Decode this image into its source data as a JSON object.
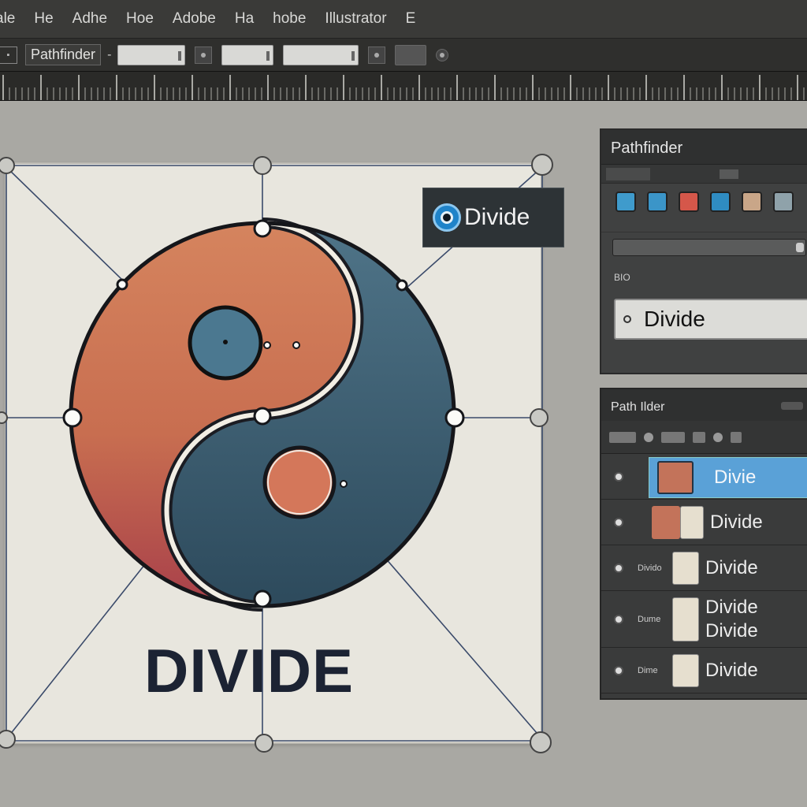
{
  "app": {
    "menu": [
      "ale",
      "He",
      "Adhe",
      "Hoe",
      "Adobe",
      "Ha",
      "hobe",
      "Illustrator",
      "E"
    ]
  },
  "control_bar": {
    "panel_label": "Pathfinder",
    "separator": "-"
  },
  "tooltip": {
    "label": "Divide"
  },
  "canvas": {
    "heading": "DIVIDE"
  },
  "pathfinder_panel": {
    "title": "Pathfinder",
    "swatch_colors": [
      "#3f9bcc",
      "#3b95c8",
      "#d5574a",
      "#2f8cc2",
      "#c9a688",
      "#8fa2aa"
    ],
    "mini_label": "BIO",
    "field_value": "Divide"
  },
  "layers_panel": {
    "title": "Path Ilder",
    "rows": [
      {
        "label": "Divie",
        "small": "",
        "active": true
      },
      {
        "label": "Divide",
        "small": "",
        "active": false
      },
      {
        "label": "Divide",
        "small": "Divido",
        "active": false
      },
      {
        "label": "Divide",
        "label2": "Divide",
        "small": "Dume",
        "active": false
      },
      {
        "label": "Divide",
        "small": "Dime",
        "active": false
      }
    ]
  },
  "colors": {
    "orange": "#d07a55",
    "red": "#b24a48",
    "teal": "#3d6478",
    "dark_navy": "#1c2333",
    "accent_blue": "#5aa1d7"
  }
}
